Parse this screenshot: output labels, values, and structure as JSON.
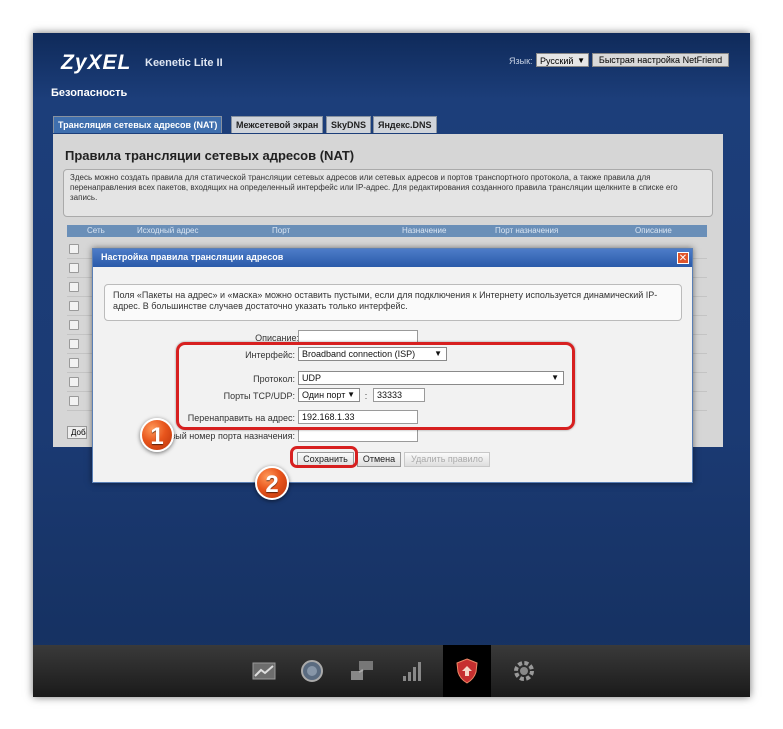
{
  "header": {
    "logo": "ZyXEL",
    "model": "Keenetic Lite II",
    "language_label": "Язык:",
    "language_value": "Русский",
    "quick_setup_label": "Быстрая настройка NetFriend"
  },
  "page": {
    "section_title": "Безопасность"
  },
  "tabs": [
    {
      "label": "Трансляция сетевых адресов (NAT)",
      "active": true
    },
    {
      "label": "Межсетевой экран",
      "active": false
    },
    {
      "label": "SkyDNS",
      "active": false
    },
    {
      "label": "Яндекс.DNS",
      "active": false
    }
  ],
  "panel": {
    "title": "Правила трансляции сетевых адресов (NAT)",
    "description": "Здесь можно создать правила для статической трансляции сетевых адресов или сетевых адресов и портов транспортного протокола, а также правила для перенаправления всех пакетов, входящих на определенный интерфейс или IP-адрес. Для редактирования созданного правила трансляции щелкните в списке его запись.",
    "columns": [
      "Сеть",
      "Исходный адрес",
      "Порт",
      "Назначение",
      "Порт назначения",
      "Описание"
    ],
    "add_button": "Доба"
  },
  "dialog": {
    "title": "Настройка правила трансляции адресов",
    "close_symbol": "✕",
    "info": "Поля «Пакеты на адрес» и «маска» можно оставить пустыми, если для подключения к Интернету используется динамический IP-адрес. В большинстве случаев достаточно указать только интерфейс.",
    "fields": {
      "description_label": "Описание:",
      "description_value": "",
      "interface_label": "Интерфейс:",
      "interface_value": "Broadband connection (ISP)",
      "protocol_label": "Протокол:",
      "protocol_value": "UDP",
      "ports_label": "Порты TCP/UDP:",
      "ports_mode_value": "Один порт",
      "port_separator": ":",
      "port_value": "33333",
      "redirect_label": "Перенаправить на адрес:",
      "redirect_value": "192.168.1.33",
      "dest_port_label": "Новый номер порта назначения:",
      "dest_port_value": ""
    },
    "buttons": {
      "save": "Сохранить",
      "cancel": "Отмена",
      "delete": "Удалить правило"
    }
  },
  "annotations": {
    "badge_1": "1",
    "badge_2": "2",
    "highlight_color": "#d72020"
  },
  "dock": {
    "items": [
      "chart-icon",
      "globe-icon",
      "network-icon",
      "signal-icon",
      "shield-icon",
      "gear-icon"
    ],
    "active": "shield-icon"
  }
}
